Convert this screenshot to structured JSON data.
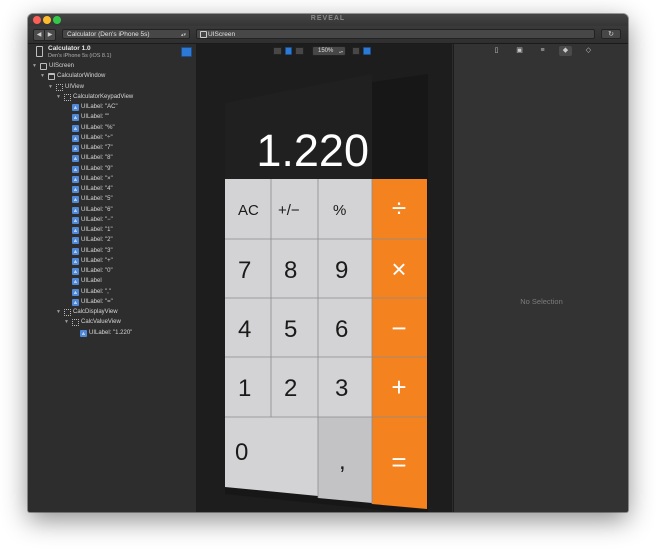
{
  "window": {
    "app_title": "REVEAL",
    "app_selector": "Calculator (Den's iPhone 5s)",
    "breadcrumb": "UIScreen"
  },
  "app_info": {
    "name": "Calculator 1.0",
    "device": "Den's iPhone 5s (iOS 8.1)"
  },
  "tree": [
    {
      "label": "UIScreen",
      "indent": 0,
      "icon": "screen",
      "disclosure": true
    },
    {
      "label": "CalculatorWindow",
      "indent": 1,
      "icon": "window",
      "disclosure": true
    },
    {
      "label": "UIView",
      "indent": 2,
      "icon": "view",
      "disclosure": true
    },
    {
      "label": "CalculatorKeypadView",
      "indent": 3,
      "icon": "view",
      "disclosure": true
    },
    {
      "label": "UILabel: \"AC\"",
      "indent": 4,
      "icon": "label",
      "disclosure": false
    },
    {
      "label": "UILabel: \"\"",
      "indent": 4,
      "icon": "label",
      "disclosure": false
    },
    {
      "label": "UILabel: \"%\"",
      "indent": 4,
      "icon": "label",
      "disclosure": false
    },
    {
      "label": "UILabel: \"÷\"",
      "indent": 4,
      "icon": "label",
      "disclosure": false
    },
    {
      "label": "UILabel: \"7\"",
      "indent": 4,
      "icon": "label",
      "disclosure": false
    },
    {
      "label": "UILabel: \"8\"",
      "indent": 4,
      "icon": "label",
      "disclosure": false
    },
    {
      "label": "UILabel: \"9\"",
      "indent": 4,
      "icon": "label",
      "disclosure": false
    },
    {
      "label": "UILabel: \"×\"",
      "indent": 4,
      "icon": "label",
      "disclosure": false
    },
    {
      "label": "UILabel: \"4\"",
      "indent": 4,
      "icon": "label",
      "disclosure": false
    },
    {
      "label": "UILabel: \"5\"",
      "indent": 4,
      "icon": "label",
      "disclosure": false
    },
    {
      "label": "UILabel: \"6\"",
      "indent": 4,
      "icon": "label",
      "disclosure": false
    },
    {
      "label": "UILabel: \"−\"",
      "indent": 4,
      "icon": "label",
      "disclosure": false
    },
    {
      "label": "UILabel: \"1\"",
      "indent": 4,
      "icon": "label",
      "disclosure": false
    },
    {
      "label": "UILabel: \"2\"",
      "indent": 4,
      "icon": "label",
      "disclosure": false
    },
    {
      "label": "UILabel: \"3\"",
      "indent": 4,
      "icon": "label",
      "disclosure": false
    },
    {
      "label": "UILabel: \"+\"",
      "indent": 4,
      "icon": "label",
      "disclosure": false
    },
    {
      "label": "UILabel: \"0\"",
      "indent": 4,
      "icon": "label",
      "disclosure": false
    },
    {
      "label": "UILabel",
      "indent": 4,
      "icon": "label",
      "disclosure": false
    },
    {
      "label": "UILabel: \",\"",
      "indent": 4,
      "icon": "label",
      "disclosure": false
    },
    {
      "label": "UILabel: \"=\"",
      "indent": 4,
      "icon": "label",
      "disclosure": false
    },
    {
      "label": "CalcDisplayView",
      "indent": 3,
      "icon": "view",
      "disclosure": true
    },
    {
      "label": "CalcValueView",
      "indent": 4,
      "icon": "view",
      "disclosure": true
    },
    {
      "label": "UILabel: \"1.220\"",
      "indent": 5,
      "icon": "label",
      "disclosure": false
    }
  ],
  "canvas": {
    "zoom": "150%"
  },
  "calculator": {
    "display": "1.220",
    "keys": {
      "ac": "AC",
      "plusminus": "+/−",
      "percent": "%",
      "divide": "÷",
      "seven": "7",
      "eight": "8",
      "nine": "9",
      "multiply": "×",
      "four": "4",
      "five": "5",
      "six": "6",
      "minus": "−",
      "one": "1",
      "two": "2",
      "three": "3",
      "plus": "+",
      "zero": "0",
      "comma": ",",
      "equals": "="
    }
  },
  "inspector": {
    "empty_state": "No Selection"
  },
  "colors": {
    "operator_orange": "#f4821f",
    "key_light": "#d3d3d5",
    "key_gray": "#c3c3c5",
    "display_bg": "#1e1e1e",
    "selection_blue": "#2d7ad6"
  }
}
